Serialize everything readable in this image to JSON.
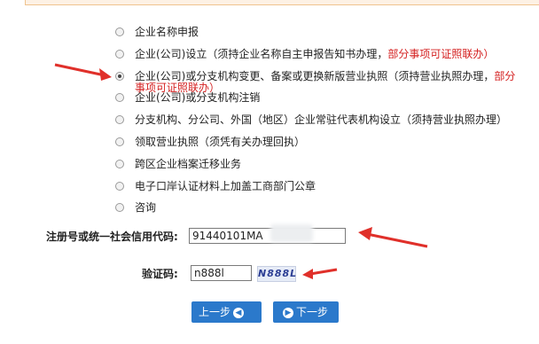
{
  "options": [
    {
      "label": "企业名称申报",
      "note": "",
      "checked": false
    },
    {
      "label": "企业(公司)设立（须持企业名称自主申报告知书办理，",
      "note": "部分事项可证照联办）",
      "checked": false
    },
    {
      "label": "企业(公司)或分支机构变更、备案或更换新版营业执照（须持营业执照办理，",
      "note": "部分",
      "note2": "事项可证照联办）",
      "checked": true
    },
    {
      "label": "企业(公司)或分支机构注销",
      "note": "",
      "checked": false
    },
    {
      "label": "分支机构、分公司、外国（地区）企业常驻代表机构设立（须持营业执照办理）",
      "note": "",
      "checked": false
    },
    {
      "label": "领取营业执照（须凭有关办理回执）",
      "note": "",
      "checked": false
    },
    {
      "label": "跨区企业档案迁移业务",
      "note": "",
      "checked": false
    },
    {
      "label": "电子口岸认证材料上加盖工商部门公章",
      "note": "",
      "checked": false
    },
    {
      "label": "咨询",
      "note": "",
      "checked": false
    }
  ],
  "form": {
    "reg_label": "注册号或统一社会信用代码:",
    "reg_value": "91440101MA",
    "captcha_label": "验证码:",
    "captcha_value": "n888l",
    "captcha_image_text": "N888L"
  },
  "buttons": {
    "prev": "上一步",
    "next": "下一步"
  },
  "colors": {
    "note_red": "#d42020",
    "button_blue": "#2b79cb",
    "arrow_red": "#e0302a"
  }
}
